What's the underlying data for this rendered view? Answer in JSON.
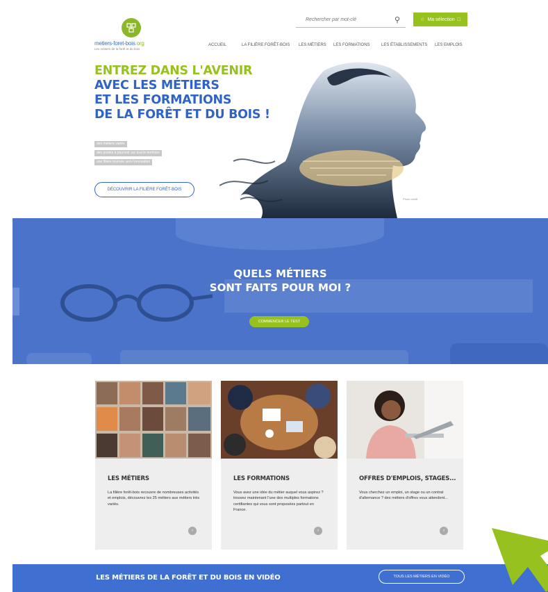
{
  "header": {
    "search_placeholder": "Rechercher par mot-clé",
    "selection_label": "Ma sélection",
    "logo": {
      "name_blue": "metiers-foret-bois",
      "name_green": ".org",
      "tagline": "Les métiers de la forêt et du bois"
    }
  },
  "nav": {
    "items": [
      "Accueil",
      "La filière forêt-bois",
      "Les métiers",
      "Les formations",
      "Les établissements",
      "Les emplois"
    ]
  },
  "hero": {
    "title_lines": [
      "ENTREZ DANS L'AVENIR",
      "AVEC LES MÉTIERS",
      "ET LES FORMATIONS",
      "DE LA FORÊT ET DU BOIS !"
    ],
    "chips": [
      "des métiers variés",
      "des postes à pourvoir sur tout le territoire",
      "une filière tournée vers l'innovation"
    ],
    "cta_label": "DÉCOUVRIR LA FILIÈRE FORÊT-BOIS"
  },
  "quiz": {
    "title_line1": "QUELS MÉTIERS",
    "title_line2": "SONT FAITS POUR MOI ?",
    "button_label": "COMMENCER LE TEST"
  },
  "cards": [
    {
      "title": "LES MÉTIERS",
      "text": "La filière forêt-bois recouvre de nombreuses activités et emplois, découvrez les 25 métiers aux métiers très variés."
    },
    {
      "title": "LES FORMATIONS",
      "text": "Vous avez une idée du métier auquel vous aspirez ? trouvez maintenant l'une des multiples formations certifiantes qui vous sont proposées partout en France."
    },
    {
      "title": "OFFRES D'EMPLOIS, STAGES...",
      "text": "Vous cherchez un emploi, un stage ou un contrat d'alternance ? des métiers d'offres vous attendent..."
    }
  ],
  "video_band": {
    "title": "LES MÉTIERS DE LA FORÊT ET DU BOIS EN VIDÉO",
    "button_label": "TOUS LES MÉTIERS EN VIDÉO"
  },
  "colors": {
    "green": "#96c11f",
    "blue": "#2f63c8",
    "band": "#4a73c9",
    "cursor": "#96c11f"
  },
  "icons": {
    "search": "magnifier-icon",
    "selection": "bookmark-icon",
    "card_arrow": "arrow-right-circle-icon",
    "pointer": "arrow-cursor-icon"
  }
}
